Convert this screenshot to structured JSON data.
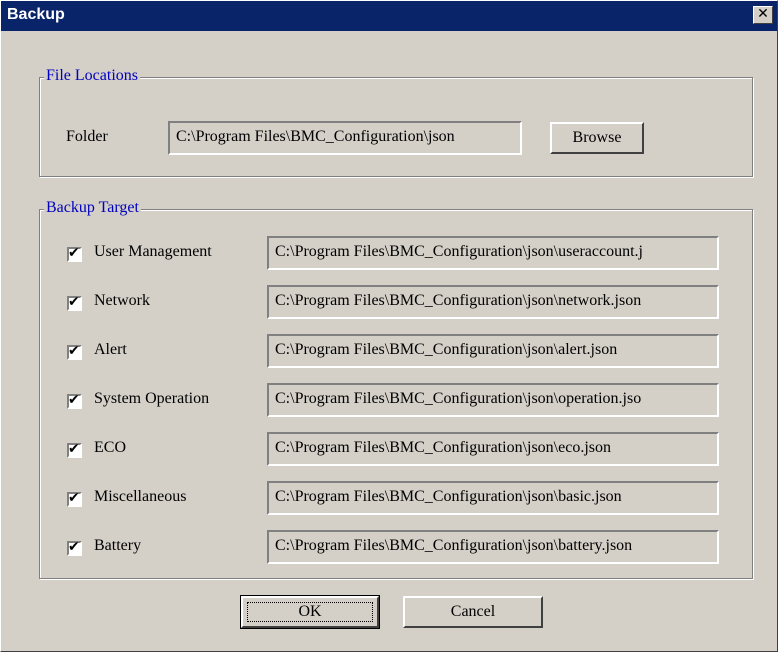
{
  "window": {
    "title": "Backup",
    "close_glyph": "✕"
  },
  "file_locations": {
    "legend": "File Locations",
    "folder_label": "Folder",
    "folder_value": "C:\\Program Files\\BMC_Configuration\\json",
    "browse_label": "Browse"
  },
  "backup_target": {
    "legend": "Backup Target",
    "items": [
      {
        "label": "User Management",
        "checked": true,
        "path": "C:\\Program Files\\BMC_Configuration\\json\\useraccount.j"
      },
      {
        "label": "Network",
        "checked": true,
        "path": "C:\\Program Files\\BMC_Configuration\\json\\network.json"
      },
      {
        "label": "Alert",
        "checked": true,
        "path": "C:\\Program Files\\BMC_Configuration\\json\\alert.json"
      },
      {
        "label": "System Operation",
        "checked": true,
        "path": "C:\\Program Files\\BMC_Configuration\\json\\operation.jso"
      },
      {
        "label": "ECO",
        "checked": true,
        "path": "C:\\Program Files\\BMC_Configuration\\json\\eco.json"
      },
      {
        "label": "Miscellaneous",
        "checked": true,
        "path": "C:\\Program Files\\BMC_Configuration\\json\\basic.json"
      },
      {
        "label": "Battery",
        "checked": true,
        "path": "C:\\Program Files\\BMC_Configuration\\json\\battery.json"
      }
    ]
  },
  "buttons": {
    "ok": "OK",
    "cancel": "Cancel"
  },
  "colors": {
    "titlebar": "#0a246a",
    "dialog": "#d4d0c8",
    "legend_text": "#0000c0"
  }
}
